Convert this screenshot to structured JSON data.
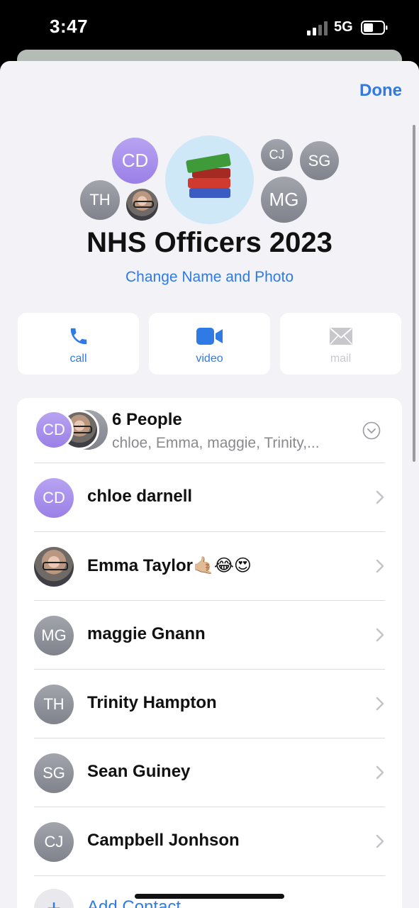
{
  "status_bar": {
    "time": "3:47",
    "network": "5G"
  },
  "header": {
    "done_label": "Done"
  },
  "group": {
    "name": "NHS Officers 2023",
    "change_link": "Change Name and Photo",
    "cluster": {
      "cd": "CD",
      "th": "TH",
      "cj": "CJ",
      "sg": "SG",
      "mg": "MG"
    }
  },
  "actions": {
    "call": "call",
    "video": "video",
    "mail": "mail"
  },
  "people": {
    "summary_title": "6 People",
    "summary_sub": "chloe, Emma, maggie, Trinity,...",
    "summary_initials": "CD",
    "members": [
      {
        "initials": "CD",
        "name": "chloe darnell"
      },
      {
        "initials": "",
        "name": "Emma Taylor🤙🏼😂😍"
      },
      {
        "initials": "MG",
        "name": "maggie Gnann"
      },
      {
        "initials": "TH",
        "name": "Trinity Hampton"
      },
      {
        "initials": "SG",
        "name": "Sean Guiney"
      },
      {
        "initials": "CJ",
        "name": "Campbell Jonhson"
      }
    ],
    "add_label": "Add Contact"
  },
  "colors": {
    "accent": "#2f7ae5",
    "purple": "#a58ceb",
    "gray": "#8e9099"
  }
}
